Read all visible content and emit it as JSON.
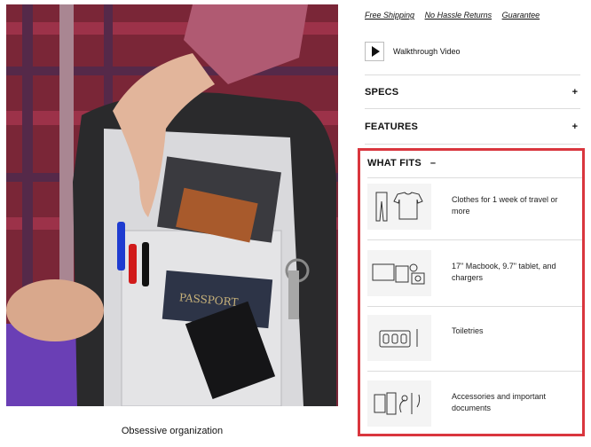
{
  "caption": "Obsessive organization",
  "links": [
    "Free Shipping",
    "No Hassle Returns",
    "Guarantee"
  ],
  "video": {
    "label": "Walkthrough Video",
    "icon": "play-icon"
  },
  "accordions": [
    {
      "title": "SPECS",
      "icon": "plus-icon",
      "glyph": "+"
    },
    {
      "title": "FEATURES",
      "icon": "plus-icon",
      "glyph": "+"
    }
  ],
  "what_fits": {
    "title": "WHAT FITS",
    "toggle": "–",
    "highlight_color": "#d9363e",
    "items": [
      {
        "text": "Clothes for 1 week of travel or more",
        "icon": "clothes-icon"
      },
      {
        "text": "17\" Macbook, 9.7\" tablet, and chargers",
        "icon": "electronics-icon"
      },
      {
        "text": "Toiletries",
        "icon": "toiletries-icon"
      },
      {
        "text": "Accessories and important documents",
        "icon": "accessories-icon"
      }
    ]
  },
  "photo": {
    "passport_text": "PASSPORT"
  }
}
